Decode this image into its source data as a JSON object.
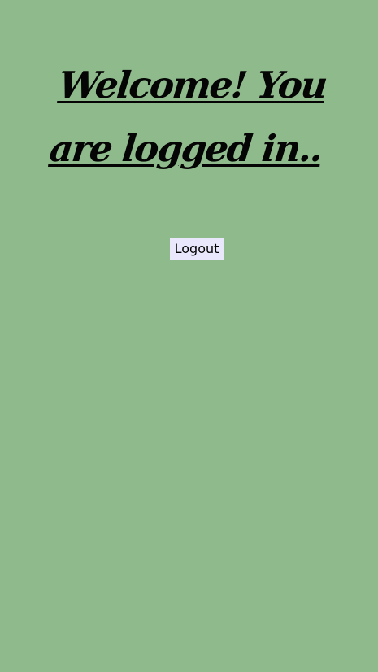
{
  "page": {
    "heading": "Welcome! You are logged in..",
    "logout_label": "Logout",
    "background_color": "#8fbb8c",
    "button_color": "#e8e7fb"
  }
}
